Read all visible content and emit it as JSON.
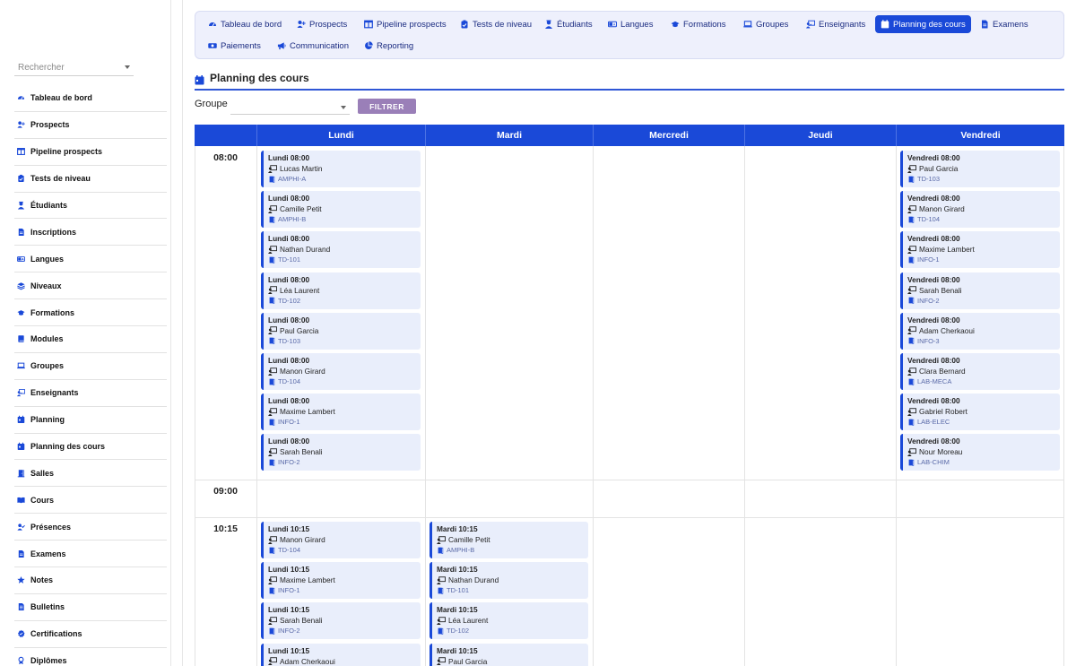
{
  "sidebar": {
    "search_placeholder": "Rechercher",
    "items": [
      {
        "label": "Tableau de bord",
        "icon": "dashboard-icon"
      },
      {
        "label": "Prospects",
        "icon": "user-plus-icon"
      },
      {
        "label": "Pipeline prospects",
        "icon": "columns-icon"
      },
      {
        "label": "Tests de niveau",
        "icon": "clipboard-icon"
      },
      {
        "label": "Étudiants",
        "icon": "student-icon"
      },
      {
        "label": "Inscriptions",
        "icon": "document-icon"
      },
      {
        "label": "Langues",
        "icon": "language-icon"
      },
      {
        "label": "Niveaux",
        "icon": "layers-icon"
      },
      {
        "label": "Formations",
        "icon": "graduation-cap-icon"
      },
      {
        "label": "Modules",
        "icon": "book-icon"
      },
      {
        "label": "Groupes",
        "icon": "laptop-icon"
      },
      {
        "label": "Enseignants",
        "icon": "teacher-icon"
      },
      {
        "label": "Planning",
        "icon": "calendar-icon"
      },
      {
        "label": "Planning des cours",
        "icon": "calendar-icon"
      },
      {
        "label": "Salles",
        "icon": "door-icon"
      },
      {
        "label": "Cours",
        "icon": "open-book-icon"
      },
      {
        "label": "Présences",
        "icon": "user-check-icon"
      },
      {
        "label": "Examens",
        "icon": "file-icon"
      },
      {
        "label": "Notes",
        "icon": "star-icon"
      },
      {
        "label": "Bulletins",
        "icon": "report-icon"
      },
      {
        "label": "Certifications",
        "icon": "certificate-icon"
      },
      {
        "label": "Diplômes",
        "icon": "medal-icon"
      }
    ]
  },
  "topnav": {
    "tabs": [
      {
        "label": "Tableau de bord",
        "icon": "dashboard-icon",
        "active": false
      },
      {
        "label": "Prospects",
        "icon": "user-plus-icon",
        "active": false
      },
      {
        "label": "Pipeline prospects",
        "icon": "columns-icon",
        "active": false
      },
      {
        "label": "Tests de niveau",
        "icon": "clipboard-icon",
        "active": false
      },
      {
        "label": "Étudiants",
        "icon": "student-icon",
        "active": false
      },
      {
        "label": "Langues",
        "icon": "language-icon",
        "active": false
      },
      {
        "label": "Formations",
        "icon": "graduation-cap-icon",
        "active": false
      },
      {
        "label": "Groupes",
        "icon": "laptop-icon",
        "active": false
      },
      {
        "label": "Enseignants",
        "icon": "teacher-icon",
        "active": false
      },
      {
        "label": "Planning des cours",
        "icon": "calendar-icon",
        "active": true
      },
      {
        "label": "Examens",
        "icon": "file-icon",
        "active": false
      },
      {
        "label": "Paiements",
        "icon": "money-icon",
        "active": false
      },
      {
        "label": "Communication",
        "icon": "megaphone-icon",
        "active": false
      },
      {
        "label": "Reporting",
        "icon": "pie-chart-icon",
        "active": false
      }
    ]
  },
  "page": {
    "title": "Planning des cours",
    "filter_label": "Groupe",
    "group_value": "",
    "filter_button": "FILTRER"
  },
  "schedule": {
    "days": [
      "Lundi",
      "Mardi",
      "Mercredi",
      "Jeudi",
      "Vendredi"
    ],
    "times": [
      "08:00",
      "09:00",
      "10:15"
    ],
    "slots": [
      {
        "time": "08:00",
        "cells": [
          [
            {
              "title": "Lundi 08:00",
              "teacher": "Lucas Martin",
              "room": "AMPHI-A"
            },
            {
              "title": "Lundi 08:00",
              "teacher": "Camille Petit",
              "room": "AMPHI-B"
            },
            {
              "title": "Lundi 08:00",
              "teacher": "Nathan Durand",
              "room": "TD-101"
            },
            {
              "title": "Lundi 08:00",
              "teacher": "Léa Laurent",
              "room": "TD-102"
            },
            {
              "title": "Lundi 08:00",
              "teacher": "Paul Garcia",
              "room": "TD-103"
            },
            {
              "title": "Lundi 08:00",
              "teacher": "Manon Girard",
              "room": "TD-104"
            },
            {
              "title": "Lundi 08:00",
              "teacher": "Maxime Lambert",
              "room": "INFO-1"
            },
            {
              "title": "Lundi 08:00",
              "teacher": "Sarah Benali",
              "room": "INFO-2"
            }
          ],
          [],
          [],
          [],
          [
            {
              "title": "Vendredi 08:00",
              "teacher": "Paul Garcia",
              "room": "TD-103"
            },
            {
              "title": "Vendredi 08:00",
              "teacher": "Manon Girard",
              "room": "TD-104"
            },
            {
              "title": "Vendredi 08:00",
              "teacher": "Maxime Lambert",
              "room": "INFO-1"
            },
            {
              "title": "Vendredi 08:00",
              "teacher": "Sarah Benali",
              "room": "INFO-2"
            },
            {
              "title": "Vendredi 08:00",
              "teacher": "Adam Cherkaoui",
              "room": "INFO-3"
            },
            {
              "title": "Vendredi 08:00",
              "teacher": "Clara Bernard",
              "room": "LAB-MECA"
            },
            {
              "title": "Vendredi 08:00",
              "teacher": "Gabriel Robert",
              "room": "LAB-ELEC"
            },
            {
              "title": "Vendredi 08:00",
              "teacher": "Nour Moreau",
              "room": "LAB-CHIM"
            }
          ]
        ]
      },
      {
        "time": "09:00",
        "cells": [
          [],
          [],
          [],
          [],
          []
        ]
      },
      {
        "time": "10:15",
        "cells": [
          [
            {
              "title": "Lundi 10:15",
              "teacher": "Manon Girard",
              "room": "TD-104"
            },
            {
              "title": "Lundi 10:15",
              "teacher": "Maxime Lambert",
              "room": "INFO-1"
            },
            {
              "title": "Lundi 10:15",
              "teacher": "Sarah Benali",
              "room": "INFO-2"
            },
            {
              "title": "Lundi 10:15",
              "teacher": "Adam Cherkaoui",
              "room": ""
            }
          ],
          [
            {
              "title": "Mardi 10:15",
              "teacher": "Camille Petit",
              "room": "AMPHI-B"
            },
            {
              "title": "Mardi 10:15",
              "teacher": "Nathan Durand",
              "room": "TD-101"
            },
            {
              "title": "Mardi 10:15",
              "teacher": "Léa Laurent",
              "room": "TD-102"
            },
            {
              "title": "Mardi 10:15",
              "teacher": "Paul Garcia",
              "room": ""
            }
          ],
          [],
          [],
          []
        ]
      }
    ]
  },
  "colors": {
    "primary": "#1a49d8",
    "card_bg": "#e9eefb",
    "nav_bg": "#eef0fc",
    "filter_button": "#9a7fb8"
  }
}
